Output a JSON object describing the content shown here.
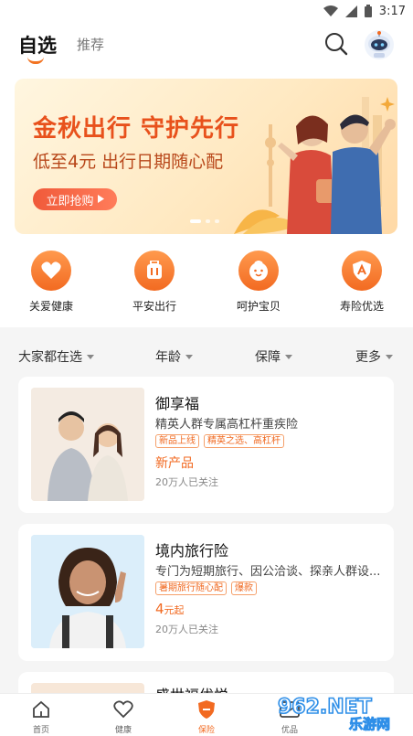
{
  "status_bar": {
    "time": "3:17"
  },
  "header": {
    "tab_main": "自选",
    "tab_second": "推荐"
  },
  "banner": {
    "title": "金秋出行  守护先行",
    "subtitle": "低至4元  出行日期随心配",
    "button": "立即抢购"
  },
  "shortcuts": [
    {
      "label": "关爱健康",
      "icon": "heart-icon"
    },
    {
      "label": "平安出行",
      "icon": "luggage-icon"
    },
    {
      "label": "呵护宝贝",
      "icon": "baby-face-icon"
    },
    {
      "label": "寿险优选",
      "icon": "shield-a-icon"
    }
  ],
  "filters": [
    "大家都在选",
    "年龄",
    "保障",
    "更多"
  ],
  "products": [
    {
      "title": "御享福",
      "desc": "精英人群专属高杠杆重疾险",
      "tags": [
        "新品上线",
        "精英之选、高杠杆"
      ],
      "price": "新产品",
      "follow": "20万人已关注"
    },
    {
      "title": "境内旅行险",
      "desc": "专门为短期旅行、因公洽谈、探亲人群设...",
      "tags": [
        "暑期旅行随心配",
        "爆款"
      ],
      "price_num": "4",
      "price_unit": "元起",
      "follow": "20万人已关注"
    },
    {
      "title": "盛世福优悦"
    }
  ],
  "bottom_nav": [
    {
      "label": "首页",
      "icon": "home-icon"
    },
    {
      "label": "健康",
      "icon": "heart-outline-icon"
    },
    {
      "label": "保险",
      "icon": "shield-icon",
      "active": true
    },
    {
      "label": "优品",
      "icon": "mail-icon"
    }
  ],
  "watermark": {
    "text": "962.NET",
    "sub": "乐游网"
  },
  "colors": {
    "accent": "#f26a21",
    "banner_red": "#e8511c"
  }
}
